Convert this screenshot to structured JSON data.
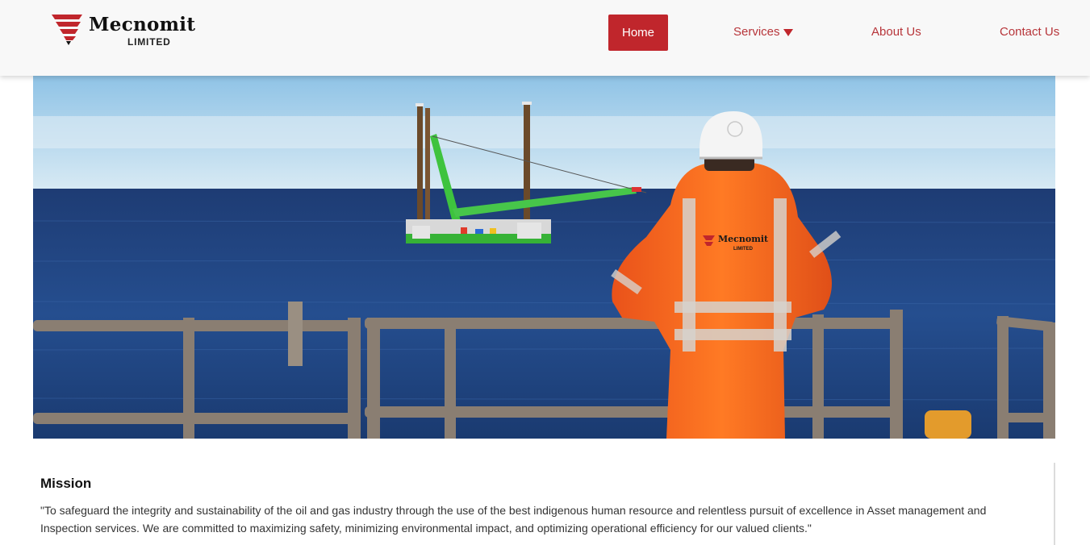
{
  "brand": {
    "name": "Mecnomit",
    "sub": "LIMITED",
    "accent": "#c0262c"
  },
  "nav": {
    "home": "Home",
    "services": "Services",
    "about": "About Us",
    "contact": "Contact Us"
  },
  "hero": {
    "vest_brand": "Mecnomit",
    "vest_sub": "LIMITED"
  },
  "mission": {
    "title": "Mission",
    "text": "\"To safeguard the integrity and sustainability of the oil and gas industry through the use of the best indigenous human resource and relentless pursuit of excellence in Asset management and Inspection services. We are committed to maximizing safety, minimizing environmental impact, and optimizing operational efficiency for our valued clients.\""
  }
}
